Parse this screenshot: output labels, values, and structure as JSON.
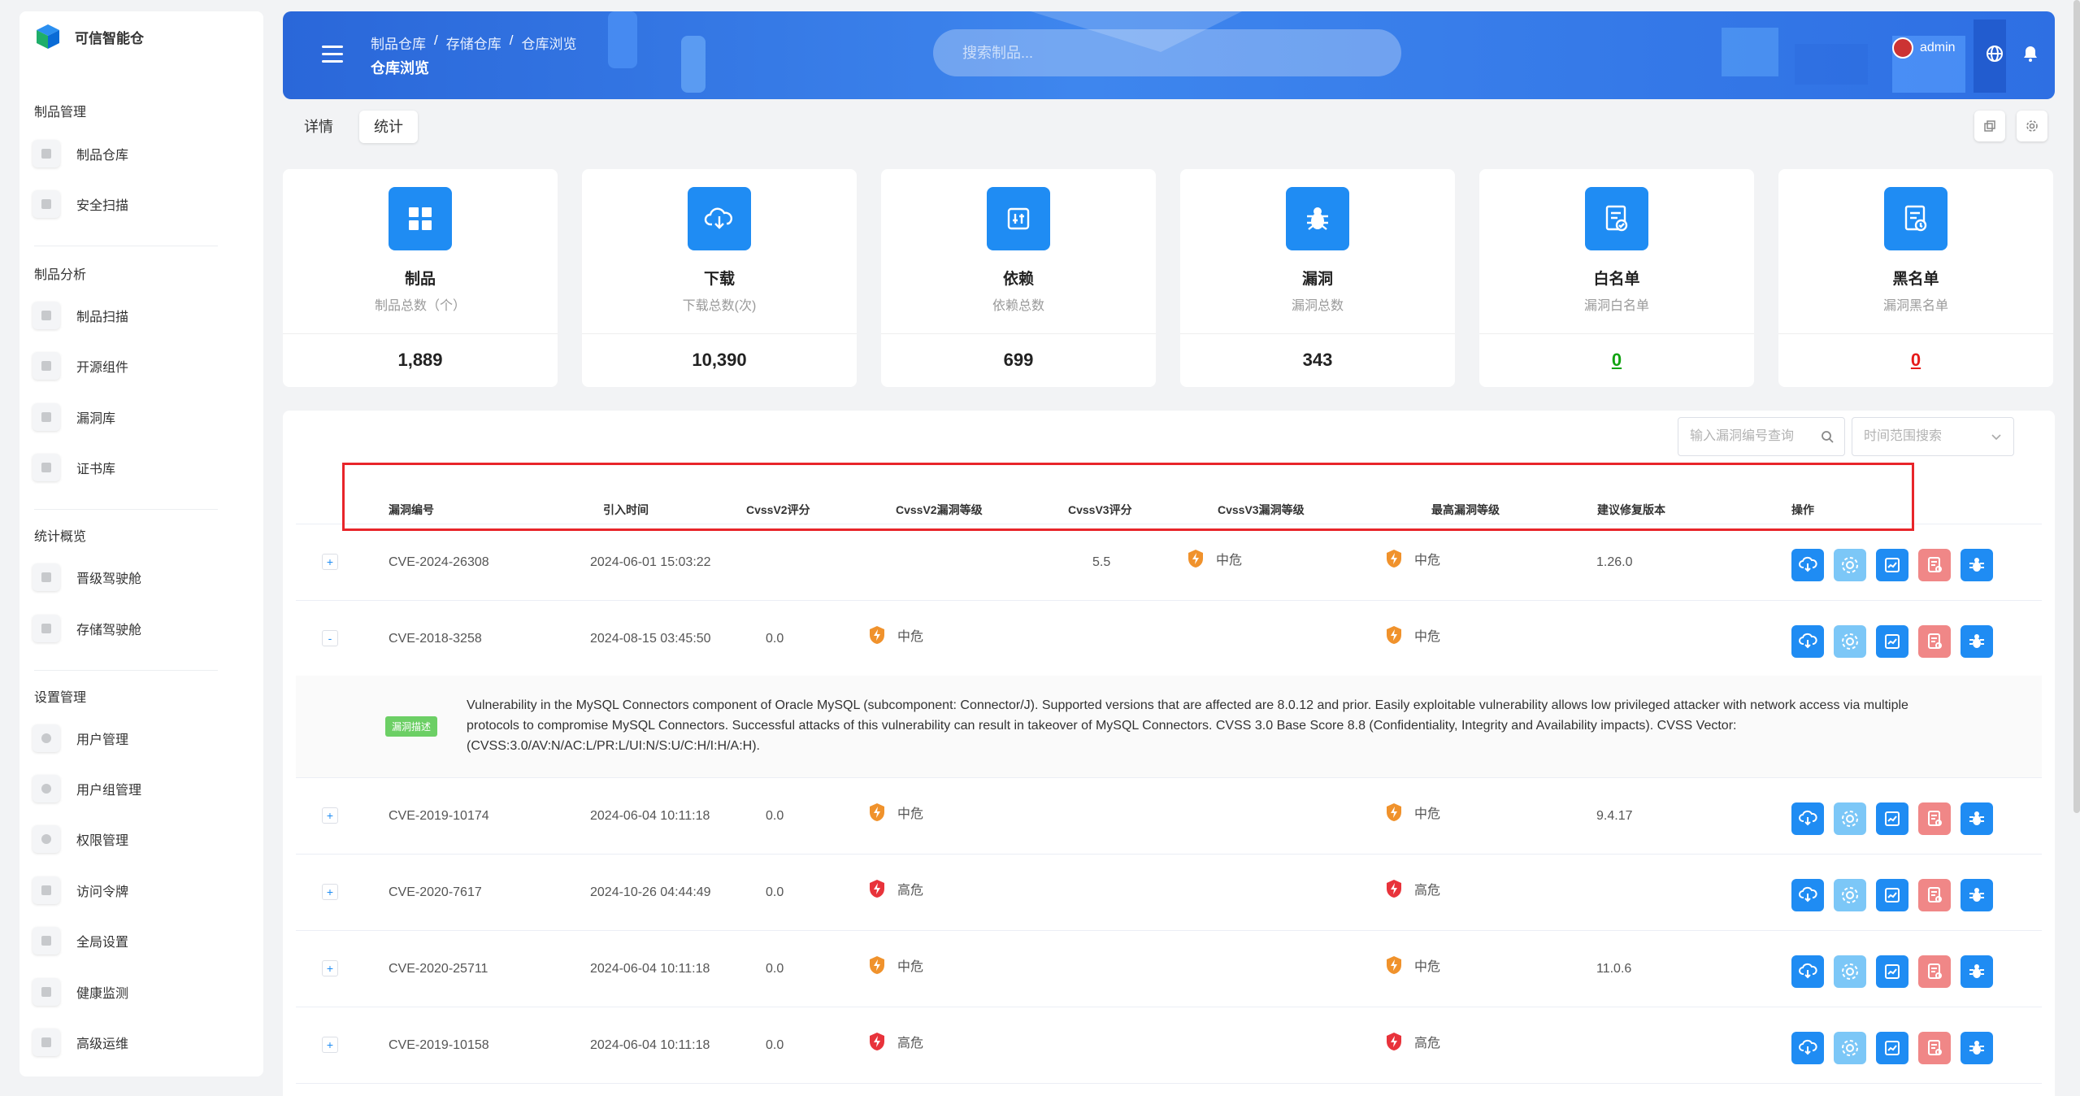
{
  "app": {
    "title": "可信智能仓"
  },
  "sidebar": {
    "sections": [
      {
        "title": "制品管理",
        "items": [
          {
            "label": "制品仓库"
          },
          {
            "label": "安全扫描"
          }
        ]
      },
      {
        "title": "制品分析",
        "items": [
          {
            "label": "制品扫描"
          },
          {
            "label": "开源组件"
          },
          {
            "label": "漏洞库"
          },
          {
            "label": "证书库"
          }
        ]
      },
      {
        "title": "统计概览",
        "items": [
          {
            "label": "晋级驾驶舱"
          },
          {
            "label": "存储驾驶舱"
          }
        ]
      },
      {
        "title": "设置管理",
        "items": [
          {
            "label": "用户管理"
          },
          {
            "label": "用户组管理"
          },
          {
            "label": "权限管理"
          },
          {
            "label": "访问令牌"
          },
          {
            "label": "全局设置"
          },
          {
            "label": "健康监测"
          },
          {
            "label": "高级运维"
          }
        ]
      }
    ]
  },
  "header": {
    "breadcrumb": [
      "制品仓库",
      "存储仓库",
      "仓库浏览"
    ],
    "breadcrumb_sep": "/",
    "page_title": "仓库浏览",
    "search_placeholder": "搜索制品...",
    "user": "admin"
  },
  "tabs": [
    {
      "label": "详情"
    },
    {
      "label": "统计",
      "active": true
    }
  ],
  "stats": [
    {
      "title": "制品",
      "subtitle": "制品总数（个）",
      "value": "1,889",
      "icon": "grid-icon"
    },
    {
      "title": "下载",
      "subtitle": "下载总数(次)",
      "value": "10,390",
      "icon": "cloud-download-icon"
    },
    {
      "title": "依赖",
      "subtitle": "依赖总数",
      "value": "699",
      "icon": "dependency-icon"
    },
    {
      "title": "漏洞",
      "subtitle": "漏洞总数",
      "value": "343",
      "icon": "bug-icon"
    },
    {
      "title": "白名单",
      "subtitle": "漏洞白名单",
      "value": "0",
      "icon": "whitelist-icon",
      "value_color": "green"
    },
    {
      "title": "黑名单",
      "subtitle": "漏洞黑名单",
      "value": "0",
      "icon": "blacklist-icon",
      "value_color": "red"
    }
  ],
  "filters": {
    "cve_placeholder": "输入漏洞编号查询",
    "range_placeholder": "时间范围搜索"
  },
  "table": {
    "headers": [
      "漏洞编号",
      "引入时间",
      "CvssV2评分",
      "CvssV2漏洞等级",
      "CvssV3评分",
      "CvssV3漏洞等级",
      "最高漏洞等级",
      "建议修复版本",
      "操作"
    ],
    "rows": [
      {
        "expand": "+",
        "cve": "CVE-2024-26308",
        "time": "2024-06-01 15:03:22",
        "v2score": "",
        "v2level": "",
        "v3score": "5.5",
        "v3level": "中危",
        "max": "中危",
        "fix": "1.26.0"
      },
      {
        "expand": "-",
        "cve": "CVE-2018-3258",
        "time": "2024-08-15 03:45:50",
        "v2score": "0.0",
        "v2level": "中危",
        "v3score": "",
        "v3level": "",
        "max": "中危",
        "fix": ""
      },
      {
        "expand": "+",
        "cve": "CVE-2019-10174",
        "time": "2024-06-04 10:11:18",
        "v2score": "0.0",
        "v2level": "中危",
        "v3score": "",
        "v3level": "",
        "max": "中危",
        "fix": "9.4.17"
      },
      {
        "expand": "+",
        "cve": "CVE-2020-7617",
        "time": "2024-10-26 04:44:49",
        "v2score": "0.0",
        "v2level": "高危",
        "v3score": "",
        "v3level": "",
        "max": "高危",
        "fix": ""
      },
      {
        "expand": "+",
        "cve": "CVE-2020-25711",
        "time": "2024-06-04 10:11:18",
        "v2score": "0.0",
        "v2level": "中危",
        "v3score": "",
        "v3level": "",
        "max": "中危",
        "fix": "11.0.6"
      },
      {
        "expand": "+",
        "cve": "CVE-2019-10158",
        "time": "2024-06-04 10:11:18",
        "v2score": "0.0",
        "v2level": "高危",
        "v3score": "",
        "v3level": "",
        "max": "高危",
        "fix": ""
      }
    ],
    "description": {
      "tag": "漏洞描述",
      "text": "Vulnerability in the MySQL Connectors component of Oracle MySQL (subcomponent: Connector/J). Supported versions that are affected are 8.0.12 and prior. Easily exploitable vulnerability allows low privileged attacker with network access via multiple protocols to compromise MySQL Connectors. Successful attacks of this vulnerability can result in takeover of MySQL Connectors. CVSS 3.0 Base Score 8.8 (Confidentiality, Integrity and Availability impacts). CVSS Vector: (CVSS:3.0/AV:N/AC:L/PR:L/UI:N/S:U/C:H/I:H/A:H)."
    }
  },
  "colors": {
    "primary": "#1f8cf3",
    "medium": "#f0922c",
    "high": "#e8333b",
    "whitelist": "#11a311",
    "blacklist": "#e61a1a",
    "highlight": "#e8252a"
  }
}
